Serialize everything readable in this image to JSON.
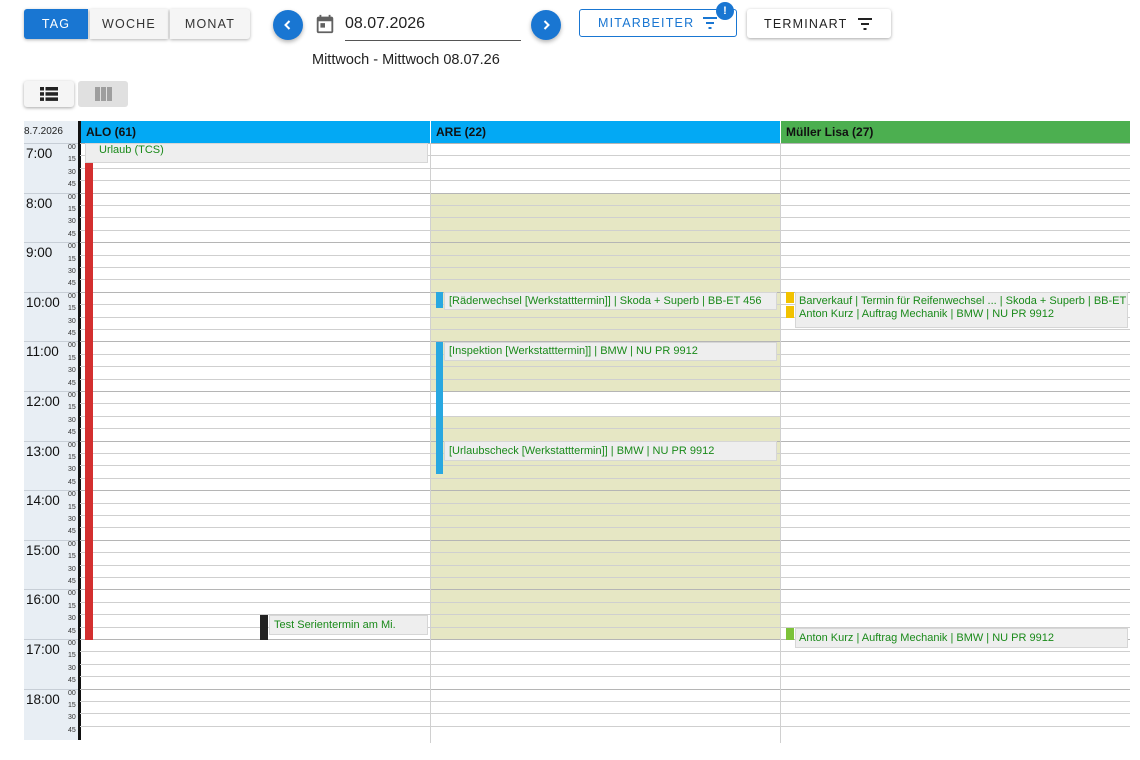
{
  "view_toggle": {
    "day": "TAG",
    "week": "WOCHE",
    "month": "MONAT"
  },
  "date_nav": {
    "date_value": "08.07.2026",
    "subtitle": "Mittwoch - Mittwoch 08.07.26"
  },
  "filters": {
    "employee_label": "MITARBEITER",
    "employee_badge": "!",
    "type_label": "TERMINART"
  },
  "calendar": {
    "date_label": "8.7.2026",
    "columns": [
      {
        "name": "ALO (61)",
        "color": "#03a9f4"
      },
      {
        "name": "ARE (22)",
        "color": "#03a9f4"
      },
      {
        "name": "Müller Lisa (27)",
        "color": "#4caf50"
      }
    ],
    "hours": [
      "7:00",
      "8:00",
      "9:00",
      "10:00",
      "11:00",
      "12:00",
      "13:00",
      "14:00",
      "15:00",
      "16:00",
      "17:00",
      "18:00"
    ],
    "minutes": [
      "00",
      "15",
      "30",
      "45"
    ],
    "events": {
      "urlaub": "Urlaub (TCS)",
      "serien": "Test Serientermin am Mi.",
      "raederwechsel": "[Räderwechsel [Werkstatttermin]] | Skoda + Superb | BB-ET 456",
      "inspektion": "[Inspektion [Werkstatttermin]] | BMW | NU PR 9912",
      "urlaubscheck": "[Urlaubscheck [Werkstatttermin]] | BMW | NU PR 9912",
      "barverkauf": "Barverkauf | Termin für Reifenwechsel ... | Skoda + Superb | BB-ET",
      "anton1": "Anton Kurz | Auftrag Mechanik | BMW | NU PR 9912",
      "anton2": "Anton Kurz | Auftrag Mechanik | BMW | NU PR 9912"
    },
    "colors": {
      "accent": "#1976d2",
      "event_text": "#1a8a1a",
      "absence": "#d32f2f",
      "blocked": "#e6e7c4"
    }
  }
}
